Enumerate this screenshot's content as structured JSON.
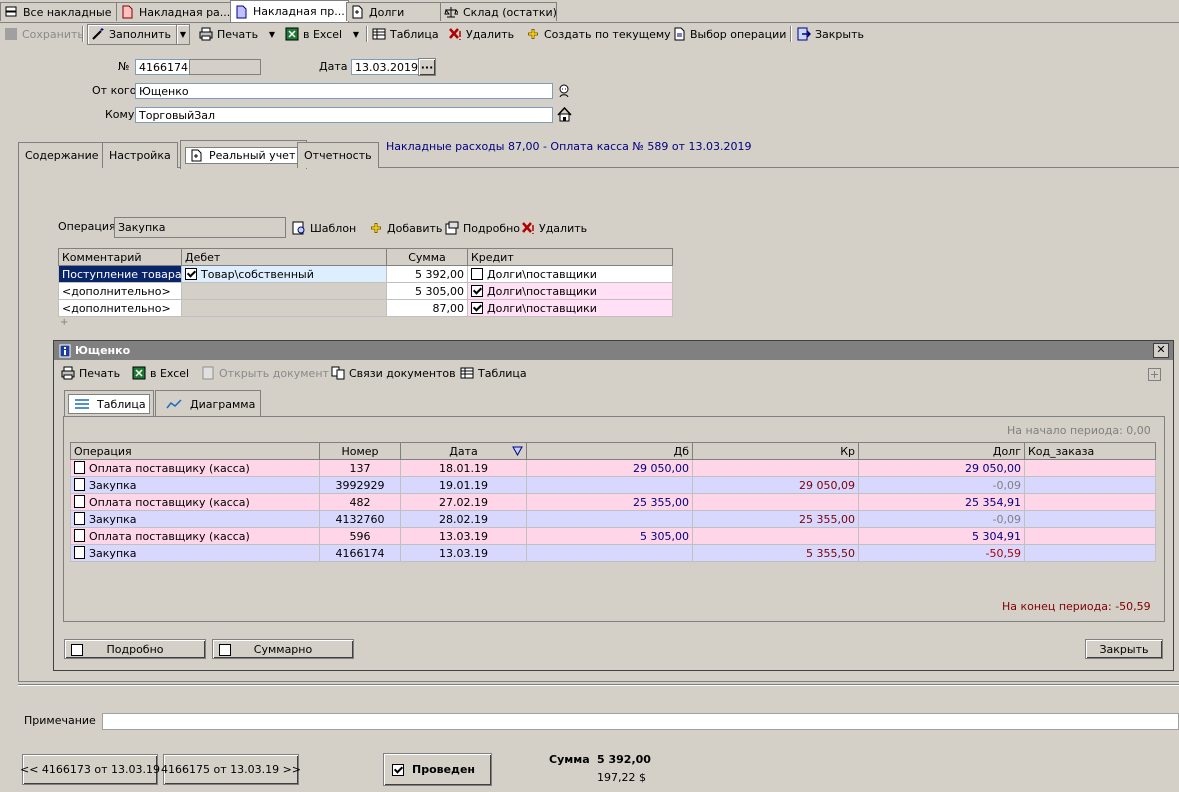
{
  "top_tabs": [
    {
      "label": "Все накладные"
    },
    {
      "label": "Накладная ра..."
    },
    {
      "label": "Накладная пр..."
    },
    {
      "label": "Долги"
    },
    {
      "label": "Склад (остатки)"
    }
  ],
  "toolbar": {
    "save": "Сохранить",
    "fill": "Заполнить",
    "print": "Печать",
    "excel": "в Excel",
    "table": "Таблица",
    "delete": "Удалить",
    "create": "Создать по текущему",
    "op_select": "Выбор операции",
    "close": "Закрыть"
  },
  "header": {
    "num_label": "№",
    "num_value": "4166174",
    "date_label": "Дата",
    "date_value": "13.03.2019",
    "date_btn": "···",
    "from_label": "От кого",
    "from_value": "Ющенко",
    "to_label": "Кому",
    "to_value": "ТорговыйЗал"
  },
  "inner_tabs": [
    "Содержание",
    "Настройка",
    "Реальный учет",
    "Отчетность"
  ],
  "expenses_text": "Накладные расходы 87,00 - Оплата касса  № 589 от 13.03.2019",
  "operation": {
    "label": "Операция",
    "value": "Закупка",
    "template": "Шаблон",
    "add": "Добавить",
    "detail": "Подробно",
    "delete": "Удалить"
  },
  "entries": {
    "columns": [
      "Комментарий",
      "Дебет",
      "Сумма",
      "Кредит"
    ],
    "rows": [
      {
        "comment": "Поступление товара",
        "debit": "Товар\\собственный",
        "sum": "5 392,00",
        "credit": "Долги\\поставщики"
      },
      {
        "comment": "<дополнительно>",
        "debit": "",
        "sum": "5 305,00",
        "credit": "Долги\\поставщики"
      },
      {
        "comment": "<дополнительно>",
        "debit": "",
        "sum": "87,00",
        "credit": "Долги\\поставщики"
      }
    ],
    "plus": "+"
  },
  "subwin": {
    "title": "Ющенко",
    "print": "Печать",
    "excel": "в Excel",
    "open_doc": "Открыть документ",
    "links": "Связи документов",
    "table": "Таблица",
    "tab_table": "Таблица",
    "tab_chart": "Диаграмма",
    "start_period": "На начало периода:  0,00",
    "columns": [
      "Операция",
      "Номер",
      "Дата",
      "Дб",
      "Кр",
      "Долг",
      "Код_заказа"
    ],
    "rows": [
      {
        "op": "Оплата поставщику (касса)",
        "num": "137",
        "date": "18.01.19",
        "db": "29 050,00",
        "kr": "",
        "debt": "29 050,00"
      },
      {
        "op": "Закупка",
        "num": "3992929",
        "date": "19.01.19",
        "db": "",
        "kr": "29 050,09",
        "debt": "-0,09"
      },
      {
        "op": "Оплата поставщику (касса)",
        "num": "482",
        "date": "27.02.19",
        "db": "25 355,00",
        "kr": "",
        "debt": "25 354,91"
      },
      {
        "op": "Закупка",
        "num": "4132760",
        "date": "28.02.19",
        "db": "",
        "kr": "25 355,00",
        "debt": "-0,09"
      },
      {
        "op": "Оплата поставщику (касса)",
        "num": "596",
        "date": "13.03.19",
        "db": "5 305,00",
        "kr": "",
        "debt": "5 304,91"
      },
      {
        "op": "Закупка",
        "num": "4166174",
        "date": "13.03.19",
        "db": "",
        "kr": "5 355,50",
        "debt": "-50,59"
      }
    ],
    "end_period": "На конец периода:  -50,59",
    "detail_btn": "Подробно",
    "summary_btn": "Суммарно",
    "close_btn": "Закрыть"
  },
  "footer": {
    "note_label": "Примечание",
    "prev": "<< 4166173 от 13.03.19",
    "next": "4166175 от 13.03.19 >>",
    "posted": "Проведен",
    "sum_label": "Сумма",
    "sum_value": "5 392,00",
    "sum_usd": "197,22 $"
  }
}
